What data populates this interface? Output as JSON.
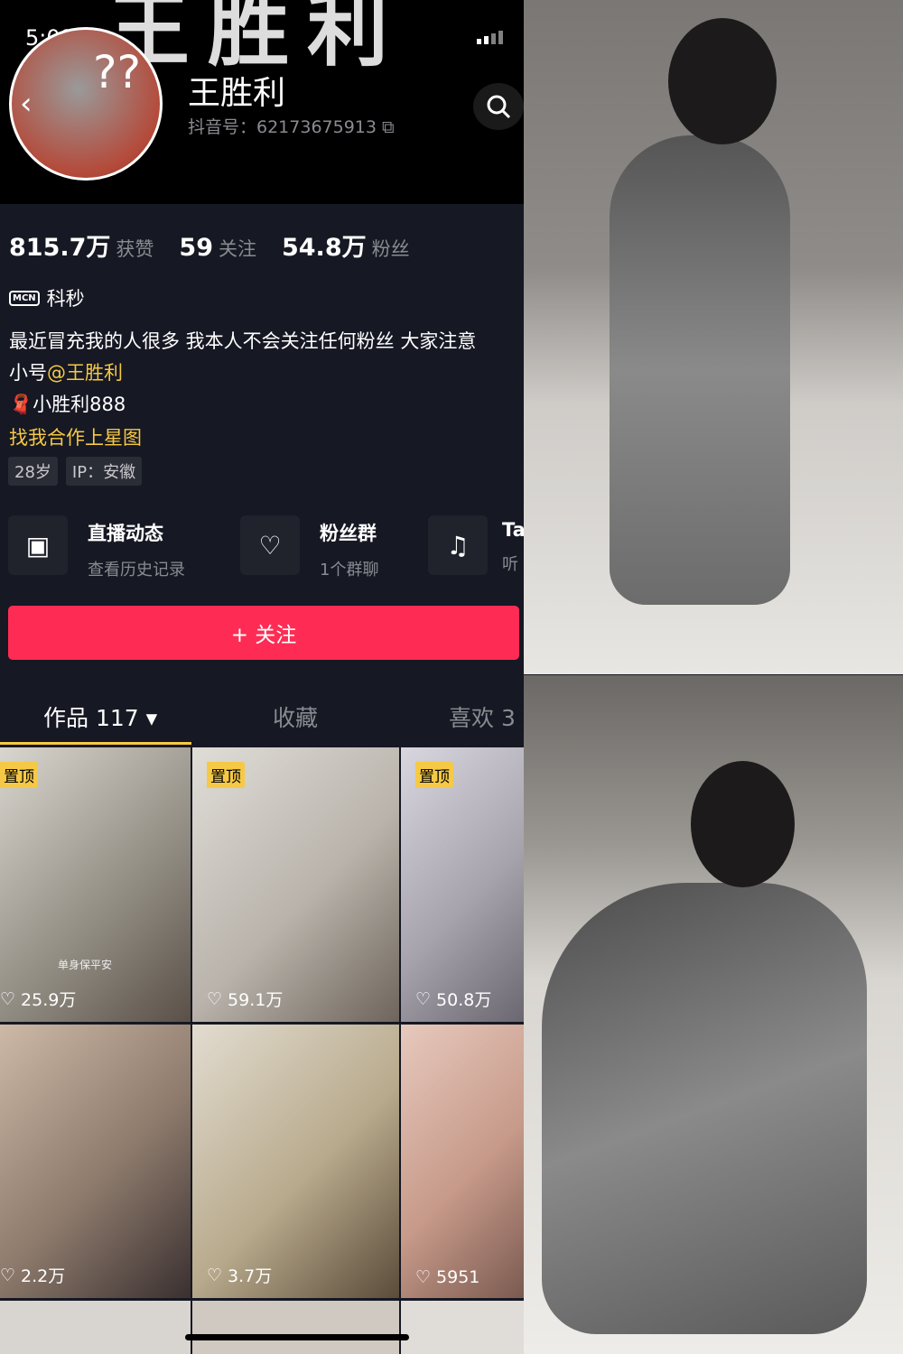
{
  "status_bar": {
    "time": "5:08"
  },
  "header": {
    "banner_text": "王胜利",
    "back_icon": "chevron-left-icon",
    "search_icon": "search-icon"
  },
  "profile": {
    "name": "王胜利",
    "douyin_id": "抖音号：62173675913",
    "avatar_text": "??"
  },
  "stats": [
    {
      "value": "815.7万",
      "label": "获赞"
    },
    {
      "value": "59",
      "label": "关注"
    },
    {
      "value": "54.8万",
      "label": "粉丝"
    }
  ],
  "mcn": {
    "badge": "MCN",
    "name": "科秒"
  },
  "bio": {
    "line1": "最近冒充我的人很多 我本人不会关注任何粉丝 大家注意",
    "line2_prefix": "小号",
    "line2_mention": "@王胜利",
    "line3": "小胜利888",
    "line4": "找我合作上星图"
  },
  "tags": [
    "28岁",
    "IP：安徽"
  ],
  "services": [
    {
      "title": "直播动态",
      "subtitle": "查看历史记录",
      "icon": "tv-play-icon"
    },
    {
      "title": "粉丝群",
      "subtitle": "1个群聊",
      "icon": "user-heart-icon"
    },
    {
      "title": "Ta",
      "subtitle": "听",
      "icon": "music-note-icon"
    }
  ],
  "follow_button": "+ 关注",
  "tabs": [
    {
      "label": "作品 117 ▾",
      "active": true
    },
    {
      "label": "收藏"
    },
    {
      "label": "喜欢 3"
    }
  ],
  "videos": [
    {
      "pinned": "置顶",
      "likes": "25.9万",
      "overlay": "单身保平安"
    },
    {
      "pinned": "置顶",
      "likes": "59.1万"
    },
    {
      "pinned": "置顶",
      "likes": "50.8万"
    },
    {
      "likes": "2.2万"
    },
    {
      "likes": "3.7万"
    },
    {
      "likes": "5951"
    }
  ],
  "colors": {
    "accent": "#fe2c55",
    "highlight": "#f5c945",
    "background": "#161823"
  }
}
